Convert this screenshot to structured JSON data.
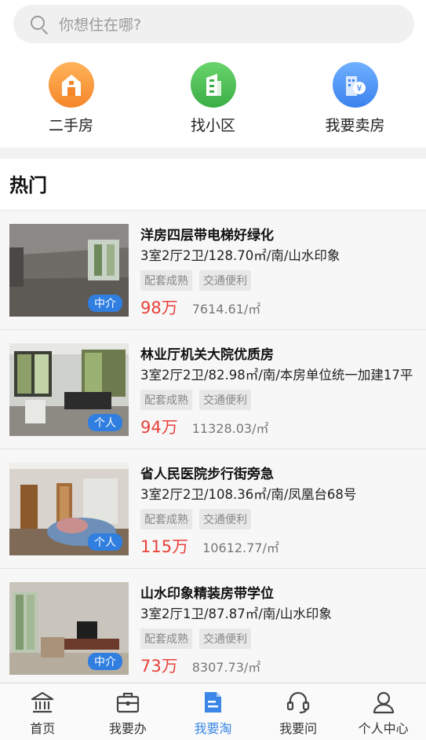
{
  "search": {
    "placeholder": "你想住在哪?"
  },
  "categories": [
    {
      "label": "二手房",
      "icon": "house-icon",
      "color": "#f5862b"
    },
    {
      "label": "找小区",
      "icon": "building-icon",
      "color": "#3aae44"
    },
    {
      "label": "我要卖房",
      "icon": "sell-house-icon",
      "color": "#3b82ee"
    }
  ],
  "section": {
    "title": "热门"
  },
  "listings": [
    {
      "title": "洋房四层带电梯好绿化",
      "detail": "3室2厅2卫/128.70㎡/南/山水印象",
      "tags": [
        "配套成熟",
        "交通便利"
      ],
      "price": "98万",
      "unit_price": "7614.61/㎡",
      "badge": "中介"
    },
    {
      "title": "林业厅机关大院优质房",
      "detail": "3室2厅2卫/82.98㎡/南/本房单位统一加建17平",
      "tags": [
        "配套成熟",
        "交通便利"
      ],
      "price": "94万",
      "unit_price": "11328.03/㎡",
      "badge": "个人"
    },
    {
      "title": "省人民医院步行街旁急",
      "detail": "3室2厅2卫/108.36㎡/南/凤凰台68号",
      "tags": [
        "配套成熟",
        "交通便利"
      ],
      "price": "115万",
      "unit_price": "10612.77/㎡",
      "badge": "个人"
    },
    {
      "title": "山水印象精装房带学位",
      "detail": "3室2厅1卫/87.87㎡/南/山水印象",
      "tags": [
        "配套成熟",
        "交通便利"
      ],
      "price": "73万",
      "unit_price": "8307.73/㎡",
      "badge": "中介"
    }
  ],
  "tabbar": {
    "active_color": "#3b86e6",
    "items": [
      {
        "label": "首页",
        "icon": "bank-icon"
      },
      {
        "label": "我要办",
        "icon": "briefcase-icon"
      },
      {
        "label": "我要淘",
        "icon": "document-icon"
      },
      {
        "label": "我要问",
        "icon": "headset-icon"
      },
      {
        "label": "个人中心",
        "icon": "user-icon"
      }
    ]
  }
}
